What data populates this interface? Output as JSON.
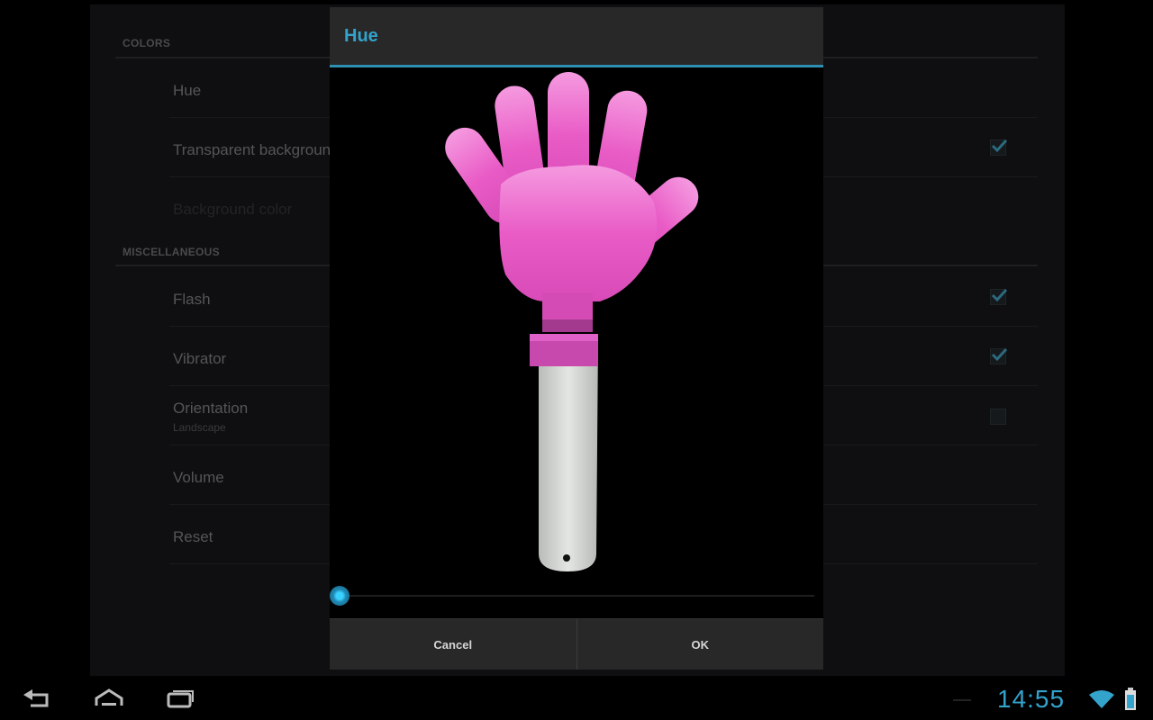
{
  "settings": {
    "categories": [
      {
        "label": "COLORS",
        "items": [
          {
            "title": "Hue",
            "summary": "",
            "enabled": true,
            "checkbox": null
          },
          {
            "title": "Transparent background",
            "summary": "",
            "enabled": true,
            "checkbox": true
          },
          {
            "title": "Background color",
            "summary": "",
            "enabled": false,
            "checkbox": null
          }
        ]
      },
      {
        "label": "MISCELLANEOUS",
        "items": [
          {
            "title": "Flash",
            "summary": "",
            "enabled": true,
            "checkbox": true
          },
          {
            "title": "Vibrator",
            "summary": "",
            "enabled": true,
            "checkbox": true
          },
          {
            "title": "Orientation",
            "summary": "Landscape",
            "enabled": true,
            "checkbox": false
          },
          {
            "title": "Volume",
            "summary": "",
            "enabled": true,
            "checkbox": null
          },
          {
            "title": "Reset",
            "summary": "",
            "enabled": true,
            "checkbox": null
          }
        ]
      }
    ]
  },
  "dialog": {
    "title": "Hue",
    "preview_image": "pink-hand-clapper",
    "hue_slider_value_fraction": 0.0,
    "cancel_label": "Cancel",
    "ok_label": "OK"
  },
  "system_bar": {
    "nav": [
      "back-icon",
      "home-icon",
      "recent-apps-icon"
    ],
    "time": "14:55",
    "status_icons": [
      "wifi-icon",
      "battery-icon"
    ]
  },
  "colors": {
    "accent": "#33a3cc",
    "hand_pink": "#e558c0",
    "handle_white": "#d9ddda"
  }
}
